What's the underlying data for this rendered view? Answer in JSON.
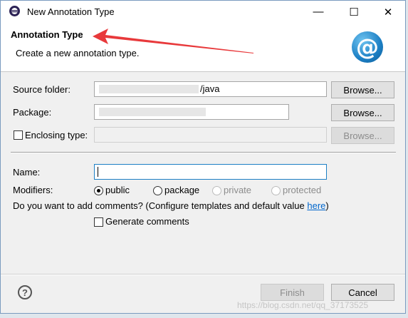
{
  "window": {
    "title": "New Annotation Type",
    "minimize_glyph": "—",
    "maximize_glyph": "☐",
    "close_glyph": "✕"
  },
  "banner": {
    "title": "Annotation Type",
    "description": "Create a new annotation type.",
    "logo_glyph": "@"
  },
  "form": {
    "source_folder": {
      "label": "Source folder:",
      "value_suffix": "/java",
      "button": "Browse..."
    },
    "package": {
      "label": "Package:",
      "button": "Browse..."
    },
    "enclosing_type": {
      "label": "Enclosing type:",
      "button": "Browse...",
      "checked": false
    },
    "name": {
      "label": "Name:",
      "value": ""
    },
    "modifiers": {
      "label": "Modifiers:",
      "options": [
        {
          "label": "public",
          "checked": true,
          "enabled": true
        },
        {
          "label": "package",
          "checked": false,
          "enabled": true
        },
        {
          "label": "private",
          "checked": false,
          "enabled": false
        },
        {
          "label": "protected",
          "checked": false,
          "enabled": false
        }
      ]
    },
    "comments_question": "Do you want to add comments? (Configure templates and default value ",
    "comments_link": "here",
    "comments_close": ")",
    "generate_comments": {
      "label": "Generate comments",
      "checked": false
    }
  },
  "footer": {
    "help_glyph": "?",
    "finish_label": "Finish",
    "cancel_label": "Cancel"
  },
  "watermark": "https://blog.csdn.net/qq_37173525",
  "colors": {
    "accent_border": "#1c7fc4",
    "arrow": "#e8393b",
    "link": "#0066cc"
  }
}
